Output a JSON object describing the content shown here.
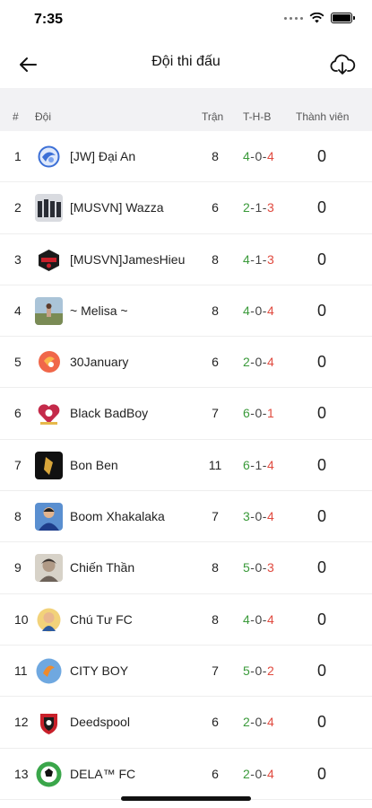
{
  "status": {
    "time": "7:35"
  },
  "header": {
    "title": "Đội thi đấu"
  },
  "table": {
    "columns": {
      "num": "#",
      "team": "Đội",
      "played": "Trận",
      "wdl": "T-H-B",
      "members": "Thành viên"
    },
    "rows": [
      {
        "num": "1",
        "name": "[JW] Đại An",
        "played": "8",
        "w": "4",
        "d": "0",
        "l": "4",
        "members": "0"
      },
      {
        "num": "2",
        "name": "[MUSVN] Wazza",
        "played": "6",
        "w": "2",
        "d": "1",
        "l": "3",
        "members": "0"
      },
      {
        "num": "3",
        "name": "[MUSVN]JamesHieu",
        "played": "8",
        "w": "4",
        "d": "1",
        "l": "3",
        "members": "0"
      },
      {
        "num": "4",
        "name": "~ Melisa ~",
        "played": "8",
        "w": "4",
        "d": "0",
        "l": "4",
        "members": "0"
      },
      {
        "num": "5",
        "name": "30January",
        "played": "6",
        "w": "2",
        "d": "0",
        "l": "4",
        "members": "0"
      },
      {
        "num": "6",
        "name": "Black BadBoy",
        "played": "7",
        "w": "6",
        "d": "0",
        "l": "1",
        "members": "0"
      },
      {
        "num": "7",
        "name": "Bon Ben",
        "played": "11",
        "w": "6",
        "d": "1",
        "l": "4",
        "members": "0"
      },
      {
        "num": "8",
        "name": "Boom Xhakalaka",
        "played": "7",
        "w": "3",
        "d": "0",
        "l": "4",
        "members": "0"
      },
      {
        "num": "9",
        "name": "Chiến Thần",
        "played": "8",
        "w": "5",
        "d": "0",
        "l": "3",
        "members": "0"
      },
      {
        "num": "10",
        "name": "Chú Tư FC",
        "played": "8",
        "w": "4",
        "d": "0",
        "l": "4",
        "members": "0"
      },
      {
        "num": "11",
        "name": "CITY BOY",
        "played": "7",
        "w": "5",
        "d": "0",
        "l": "2",
        "members": "0"
      },
      {
        "num": "12",
        "name": "Deedspool",
        "played": "6",
        "w": "2",
        "d": "0",
        "l": "4",
        "members": "0"
      },
      {
        "num": "13",
        "name": "DELA™ FC",
        "played": "6",
        "w": "2",
        "d": "0",
        "l": "4",
        "members": "0"
      }
    ]
  },
  "colors": {
    "win": "#3a9a3a",
    "loss": "#e04a3f",
    "header_bg": "#f2f2f4"
  },
  "icons": {
    "back": "arrow-left-icon",
    "download": "cloud-download-icon"
  }
}
